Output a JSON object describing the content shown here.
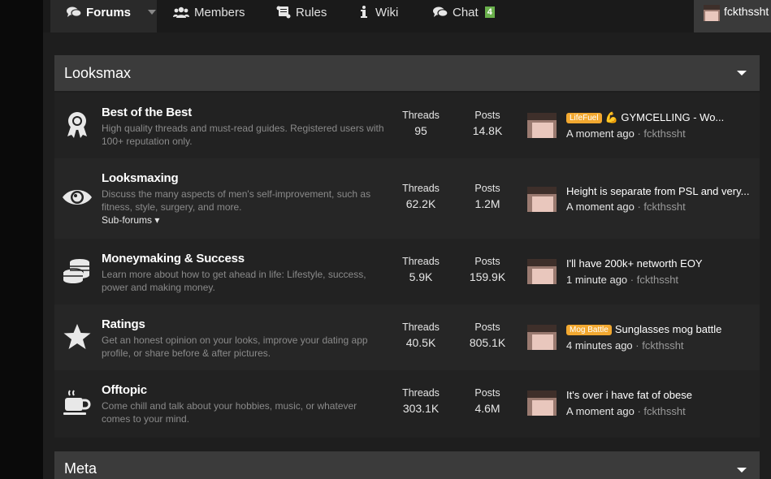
{
  "nav": {
    "forums": "Forums",
    "members": "Members",
    "rules": "Rules",
    "wiki": "Wiki",
    "chat": "Chat",
    "chat_badge": "4",
    "username": "fckthssht"
  },
  "category": {
    "title": "Looksmax",
    "next_title": "Meta"
  },
  "forums": [
    {
      "title": "Best of the Best",
      "desc": "High quality threads and must-read guides. Registered users with 100+ reputation only.",
      "threads_label": "Threads",
      "threads": "95",
      "posts_label": "Posts",
      "posts": "14.8K",
      "last_prefix": "LifeFuel",
      "last_title": "💪 GYMCELLING - Wo...",
      "last_time": "A moment ago",
      "last_user": "fckthssht"
    },
    {
      "title": "Looksmaxing",
      "desc": "Discuss the many aspects of men's self-improvement, such as fitness, style, surgery, and more.",
      "subforums": "Sub-forums ▾",
      "threads_label": "Threads",
      "threads": "62.2K",
      "posts_label": "Posts",
      "posts": "1.2M",
      "last_title": "Height is separate from PSL and very...",
      "last_time": "A moment ago",
      "last_user": "fckthssht"
    },
    {
      "title": "Moneymaking & Success",
      "desc": "Learn more about how to get ahead in life: Lifestyle, success, power and making money.",
      "threads_label": "Threads",
      "threads": "5.9K",
      "posts_label": "Posts",
      "posts": "159.9K",
      "last_title": "I'll have 200k+ networth EOY",
      "last_time": "1 minute ago",
      "last_user": "fckthssht"
    },
    {
      "title": "Ratings",
      "desc": "Get an honest opinion on your looks, improve your dating app profile, or share before & after pictures.",
      "threads_label": "Threads",
      "threads": "40.5K",
      "posts_label": "Posts",
      "posts": "805.1K",
      "last_prefix": "Mog Battle",
      "last_title": "Sunglasses mog battle",
      "last_time": "4 minutes ago",
      "last_user": "fckthssht"
    },
    {
      "title": "Offtopic",
      "desc": "Come chill and talk about your hobbies, music, or whatever comes to your mind.",
      "threads_label": "Threads",
      "threads": "303.1K",
      "posts_label": "Posts",
      "posts": "4.6M",
      "last_title": "It's over i have fat of obese",
      "last_time": "A moment ago",
      "last_user": "fckthssht"
    }
  ],
  "meta_separator": " · ",
  "colors": {
    "prefix": "#f2a830",
    "chat_badge": "#6ab04c",
    "header": "#3b3b3b"
  }
}
